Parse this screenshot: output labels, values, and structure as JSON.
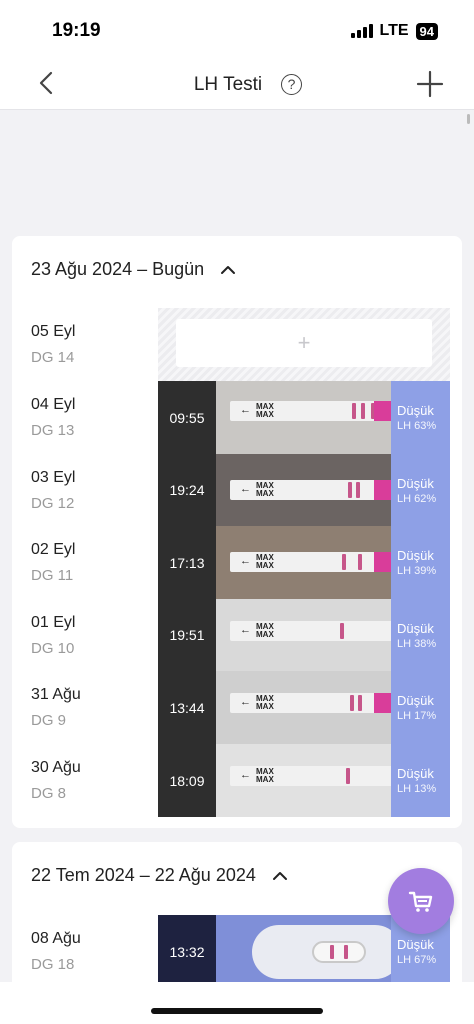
{
  "status": {
    "time": "19:19",
    "network": "LTE",
    "battery": "94"
  },
  "nav": {
    "title": "LH Testi",
    "help": "?"
  },
  "groups": [
    {
      "title": "23 Ağu 2024 – Bugün",
      "add_row": {
        "date": "05 Eyl",
        "dg": "DG 14",
        "add_label": "+"
      },
      "rows": [
        {
          "date": "04 Eyl",
          "dg": "DG 13",
          "time": "09:55",
          "result": "Düşük",
          "lh": "LH 63%",
          "lh_value": 0.63
        },
        {
          "date": "03 Eyl",
          "dg": "DG 12",
          "time": "19:24",
          "result": "Düşük",
          "lh": "LH 62%",
          "lh_value": 0.62
        },
        {
          "date": "02 Eyl",
          "dg": "DG 11",
          "time": "17:13",
          "result": "Düşük",
          "lh": "LH 39%",
          "lh_value": 0.39
        },
        {
          "date": "01 Eyl",
          "dg": "DG 10",
          "time": "19:51",
          "result": "Düşük",
          "lh": "LH 38%",
          "lh_value": 0.38
        },
        {
          "date": "31 Ağu",
          "dg": "DG 9",
          "time": "13:44",
          "result": "Düşük",
          "lh": "LH 17%",
          "lh_value": 0.17
        },
        {
          "date": "30 Ağu",
          "dg": "DG 8",
          "time": "18:09",
          "result": "Düşük",
          "lh": "LH 13%",
          "lh_value": 0.13
        }
      ]
    },
    {
      "title": "22 Tem 2024 – 22 Ağu 2024",
      "rows": [
        {
          "date": "08 Ağu",
          "dg": "DG 18",
          "time": "13:32",
          "result": "Düşük",
          "lh": "LH 67%",
          "lh_value": 0.67
        }
      ]
    }
  ],
  "colors": {
    "result_bg": "#8ea0e6",
    "time_bg": "#2e2e2e",
    "fab": "#a27de0",
    "test_line": "#c6568a"
  },
  "icons": {
    "back": "chevron-left-icon",
    "add": "plus-icon",
    "help": "question-circle-icon",
    "collapse": "chevron-up-icon",
    "cart": "cart-icon"
  }
}
